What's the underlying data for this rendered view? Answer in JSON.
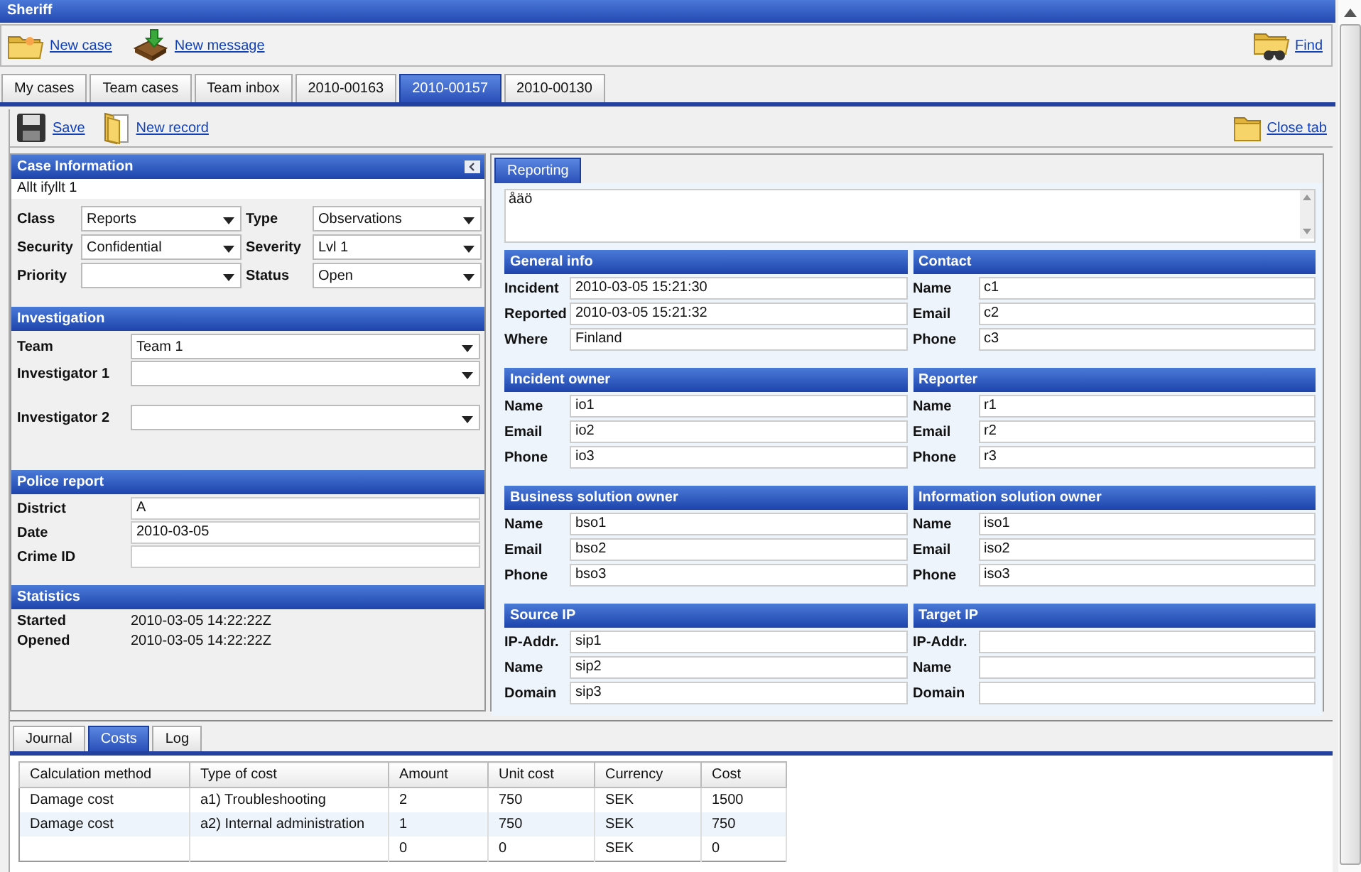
{
  "app_title": "Sheriff",
  "toolbar": {
    "new_case": "New case",
    "new_message": "New message",
    "find": "Find"
  },
  "tabs": [
    {
      "label": "My cases",
      "selected": false
    },
    {
      "label": "Team cases",
      "selected": false
    },
    {
      "label": "Team inbox",
      "selected": false
    },
    {
      "label": "2010-00163",
      "selected": false
    },
    {
      "label": "2010-00157",
      "selected": true
    },
    {
      "label": "2010-00130",
      "selected": false
    }
  ],
  "case_toolbar": {
    "save": "Save",
    "new_record": "New record",
    "close_tab": "Close tab"
  },
  "case_information": {
    "title": "Case Information",
    "summary": "Allt ifyllt 1",
    "fields": [
      {
        "label": "Class",
        "value": "Reports"
      },
      {
        "label": "Type",
        "value": "Observations"
      },
      {
        "label": "Security",
        "value": "Confidential"
      },
      {
        "label": "Severity",
        "value": "Lvl 1"
      },
      {
        "label": "Priority"
      },
      {
        "label": "Status",
        "value": "Open"
      }
    ]
  },
  "investigation": {
    "title": "Investigation",
    "fields": [
      {
        "label": "Team",
        "value": "Team 1"
      },
      {
        "label": "Investigator 1"
      },
      {
        "label": "Investigator 2"
      }
    ]
  },
  "police_report": {
    "title": "Police report",
    "fields": [
      {
        "label": "District",
        "value": "A"
      },
      {
        "label": "Date",
        "value": "2010-03-05"
      },
      {
        "label": "Crime ID"
      }
    ]
  },
  "statistics": {
    "title": "Statistics",
    "rows": [
      {
        "label": "Started",
        "value": "2010-03-05 14:22:22Z"
      },
      {
        "label": "Opened",
        "value": "2010-03-05 14:22:22Z"
      }
    ]
  },
  "reporting_tabs": [
    {
      "label": "Reporting",
      "selected": true
    }
  ],
  "description": "åäö",
  "sections": [
    {
      "title": "General info",
      "fields": [
        {
          "label": "Incident",
          "value": "2010-03-05 15:21:30"
        },
        {
          "label": "Reported",
          "value": "2010-03-05 15:21:32"
        },
        {
          "label": "Where",
          "value": "Finland"
        }
      ]
    },
    {
      "title": "Contact",
      "fields": [
        {
          "label": "Name",
          "value": "c1"
        },
        {
          "label": "Email",
          "value": "c2"
        },
        {
          "label": "Phone",
          "value": "c3"
        }
      ]
    },
    {
      "title": "Incident owner",
      "fields": [
        {
          "label": "Name",
          "value": "io1"
        },
        {
          "label": "Email",
          "value": "io2"
        },
        {
          "label": "Phone",
          "value": "io3"
        }
      ]
    },
    {
      "title": "Reporter",
      "fields": [
        {
          "label": "Name",
          "value": "r1"
        },
        {
          "label": "Email",
          "value": "r2"
        },
        {
          "label": "Phone",
          "value": "r3"
        }
      ]
    },
    {
      "title": "Business solution owner",
      "fields": [
        {
          "label": "Name",
          "value": "bso1"
        },
        {
          "label": "Email",
          "value": "bso2"
        },
        {
          "label": "Phone",
          "value": "bso3"
        }
      ]
    },
    {
      "title": "Information solution owner",
      "fields": [
        {
          "label": "Name",
          "value": "iso1"
        },
        {
          "label": "Email",
          "value": "iso2"
        },
        {
          "label": "Phone",
          "value": "iso3"
        }
      ]
    },
    {
      "title": "Source IP",
      "fields": [
        {
          "label": "IP-Addr.",
          "value": "sip1"
        },
        {
          "label": "Name",
          "value": "sip2"
        },
        {
          "label": "Domain",
          "value": "sip3"
        }
      ]
    },
    {
      "title": "Target IP",
      "fields": [
        {
          "label": "IP-Addr."
        },
        {
          "label": "Name"
        },
        {
          "label": "Domain"
        }
      ]
    }
  ],
  "bottom_tabs": [
    {
      "label": "Journal",
      "selected": false
    },
    {
      "label": "Costs",
      "selected": true
    },
    {
      "label": "Log",
      "selected": false
    }
  ],
  "costs_table": {
    "columns": [
      "Calculation method",
      "Type of cost",
      "Amount",
      "Unit cost",
      "Currency",
      "Cost"
    ],
    "rows": [
      [
        "Damage cost",
        "a1) Troubleshooting",
        "2",
        "750",
        "SEK",
        "1500"
      ],
      [
        "Damage cost",
        "a2) Internal administration",
        "1",
        "750",
        "SEK",
        "750"
      ],
      [
        "",
        "",
        "0",
        "0",
        "SEK",
        "0"
      ]
    ]
  }
}
